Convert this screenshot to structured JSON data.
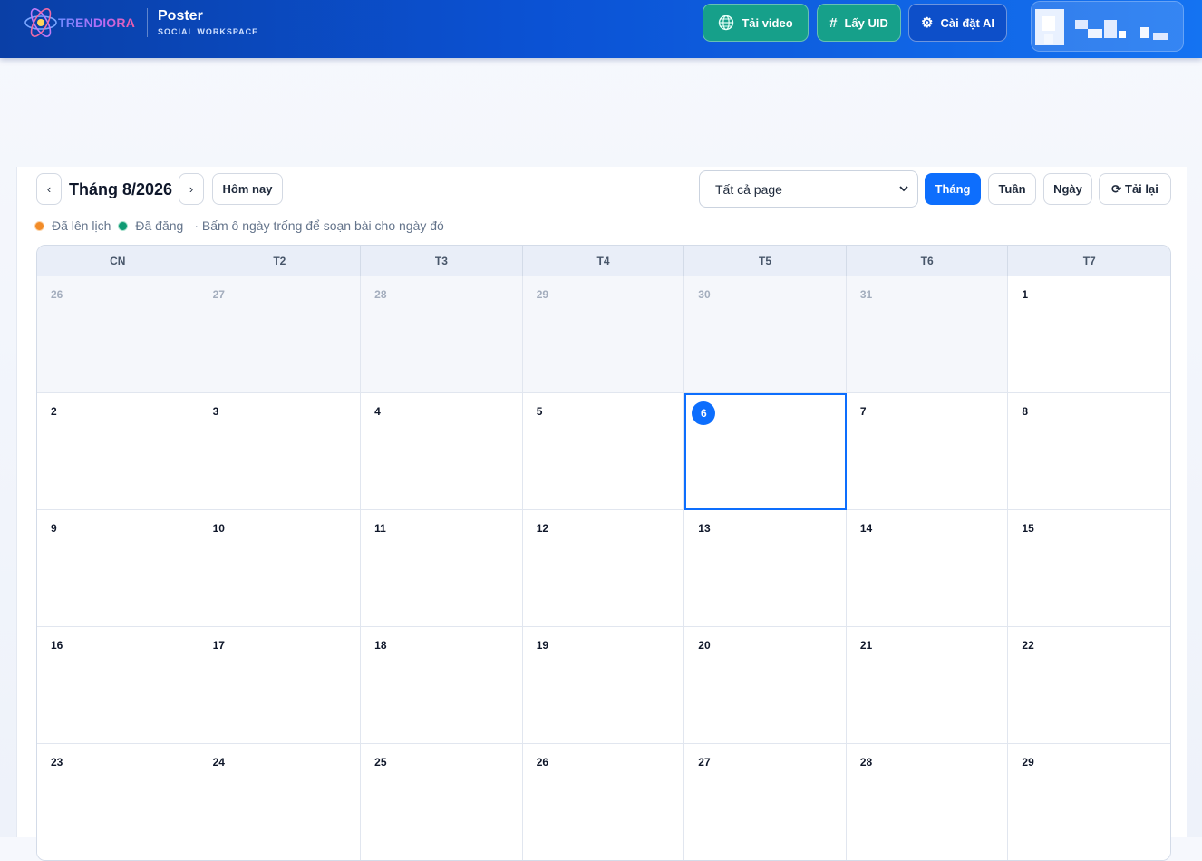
{
  "header": {
    "logo_text": "TRENDIORA",
    "app_title": "Poster",
    "app_subtitle": "SOCIAL WORKSPACE",
    "buttons": [
      {
        "label": "Tải video",
        "icon": "globe-icon"
      },
      {
        "label": "Lấy UID",
        "icon": "hash-icon"
      },
      {
        "label": "Cài đặt AI",
        "icon": "gear-icon"
      }
    ],
    "user": {
      "name": "",
      "avatar": "pixelated-avatar"
    }
  },
  "toolbar": {
    "prev": "‹",
    "next": "›",
    "month_label": "Tháng 8/2026",
    "today_label": "Hôm nay",
    "page_select": {
      "selected": "Tất cả page"
    },
    "views": [
      "Tháng",
      "Tuần",
      "Ngày"
    ],
    "active_view": "Tháng",
    "reload_label": "Tải lại",
    "reload_icon": "refresh-icon"
  },
  "legend": {
    "scheduled": "Đã lên lịch",
    "published": "Đã đăng",
    "hint": "· Bấm ô ngày trống để soạn bài cho ngày đó"
  },
  "colors": {
    "primary": "#0d6efd",
    "teal": "#16a08a",
    "scheduled": "#f28c28",
    "published": "#0f9b74"
  },
  "calendar": {
    "weekdays": [
      "CN",
      "T2",
      "T3",
      "T4",
      "T5",
      "T6",
      "T7"
    ],
    "days": [
      {
        "n": "26",
        "muted": true
      },
      {
        "n": "27",
        "muted": true
      },
      {
        "n": "28",
        "muted": true
      },
      {
        "n": "29",
        "muted": true
      },
      {
        "n": "30",
        "muted": true
      },
      {
        "n": "31",
        "muted": true
      },
      {
        "n": "1"
      },
      {
        "n": "2"
      },
      {
        "n": "3"
      },
      {
        "n": "4"
      },
      {
        "n": "5"
      },
      {
        "n": "6",
        "today": true
      },
      {
        "n": "7"
      },
      {
        "n": "8"
      },
      {
        "n": "9"
      },
      {
        "n": "10"
      },
      {
        "n": "11"
      },
      {
        "n": "12"
      },
      {
        "n": "13"
      },
      {
        "n": "14"
      },
      {
        "n": "15"
      },
      {
        "n": "16"
      },
      {
        "n": "17"
      },
      {
        "n": "18"
      },
      {
        "n": "19"
      },
      {
        "n": "20"
      },
      {
        "n": "21"
      },
      {
        "n": "22"
      },
      {
        "n": "23"
      },
      {
        "n": "24"
      },
      {
        "n": "25"
      },
      {
        "n": "26"
      },
      {
        "n": "27"
      },
      {
        "n": "28"
      },
      {
        "n": "29"
      }
    ]
  }
}
